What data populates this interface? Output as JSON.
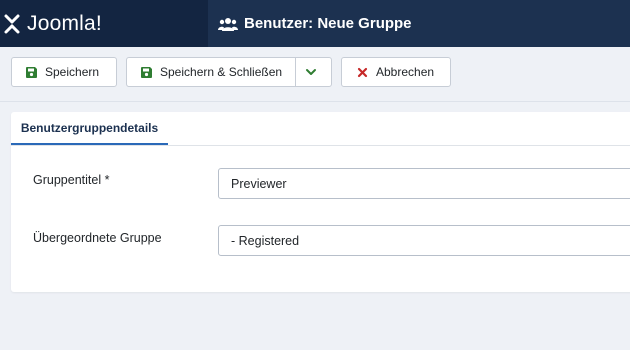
{
  "header": {
    "brand": "Joomla!",
    "title": "Benutzer: Neue Gruppe"
  },
  "toolbar": {
    "save_label": "Speichern",
    "save_close_label": "Speichern & Schließen",
    "cancel_label": "Abbrechen"
  },
  "tabs": [
    {
      "label": "Benutzergruppendetails",
      "active": true
    }
  ],
  "form": {
    "group_title_label": "Gruppentitel *",
    "group_title_value": "Previewer",
    "parent_group_label": "Übergeordnete Gruppe",
    "parent_group_value": "- Registered"
  },
  "colors": {
    "header_bg": "#1c3150",
    "brand_bg": "#132541",
    "save_icon": "#2f7d32",
    "cancel_icon": "#c62828",
    "tab_accent": "#2a69b8"
  },
  "icons": {
    "brand": "joomla-logo-icon",
    "title": "users-icon",
    "save": "save-icon",
    "save_close": "save-icon",
    "dropdown": "chevron-down-icon",
    "cancel": "close-icon"
  }
}
